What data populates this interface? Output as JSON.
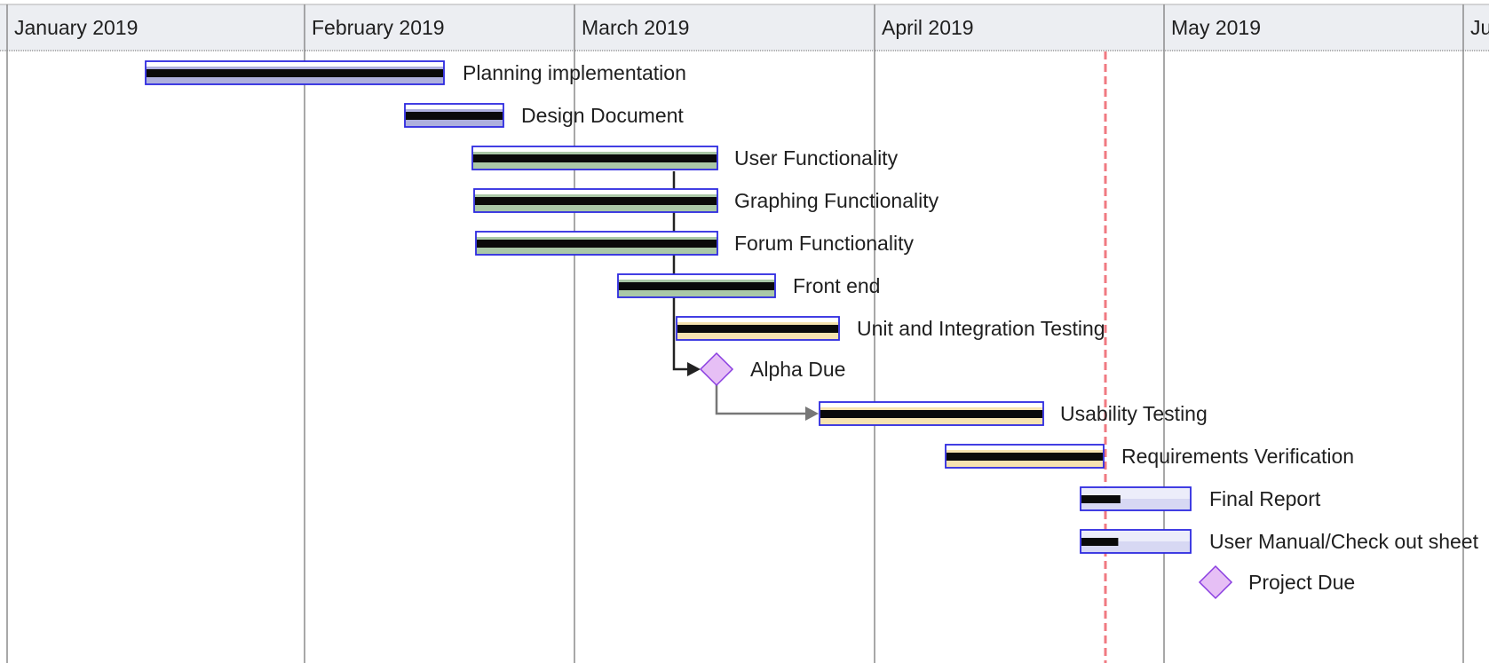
{
  "timeline": {
    "months": [
      "January 2019",
      "February 2019",
      "March 2019",
      "April 2019",
      "May 2019",
      "Ju"
    ],
    "today_marker_color": "#f07a82"
  },
  "colors": {
    "header_bg": "#eceef2",
    "grid_line": "#8c8c8c",
    "bar_border": "#2d2ae0",
    "progress": "#0a0a0a",
    "fill_violet": "#aeb0dd",
    "fill_sage": "#aac8a7",
    "fill_cream": "#f6e3b0",
    "fill_lavender": "#d7d8f3",
    "milestone_fill": "#e6bff5",
    "milestone_border": "#8a3ee0",
    "dependency": "#555555",
    "dependency_dark": "#222222"
  },
  "tasks": [
    {
      "name": "Planning implementation",
      "type": "bar",
      "fill": "violet",
      "progress_pct": 100
    },
    {
      "name": "Design Document",
      "type": "bar",
      "fill": "violet",
      "progress_pct": 100
    },
    {
      "name": "User Functionality",
      "type": "bar",
      "fill": "sage",
      "progress_pct": 100
    },
    {
      "name": "Graphing Functionality",
      "type": "bar",
      "fill": "sage",
      "progress_pct": 100
    },
    {
      "name": "Forum Functionality",
      "type": "bar",
      "fill": "sage",
      "progress_pct": 100
    },
    {
      "name": "Front end",
      "type": "bar",
      "fill": "sage",
      "progress_pct": 100
    },
    {
      "name": "Unit and Integration Testing",
      "type": "bar",
      "fill": "cream",
      "progress_pct": 100
    },
    {
      "name": "Alpha Due",
      "type": "milestone"
    },
    {
      "name": "Usability Testing",
      "type": "bar",
      "fill": "cream",
      "progress_pct": 100
    },
    {
      "name": "Requirements Verification",
      "type": "bar",
      "fill": "cream",
      "progress_pct": 100
    },
    {
      "name": "Final Report",
      "type": "bar",
      "fill": "lavender",
      "progress_pct": 37
    },
    {
      "name": "User Manual/Check out sheet",
      "type": "bar",
      "fill": "lavender",
      "progress_pct": 35
    },
    {
      "name": "Project Due",
      "type": "milestone"
    }
  ]
}
